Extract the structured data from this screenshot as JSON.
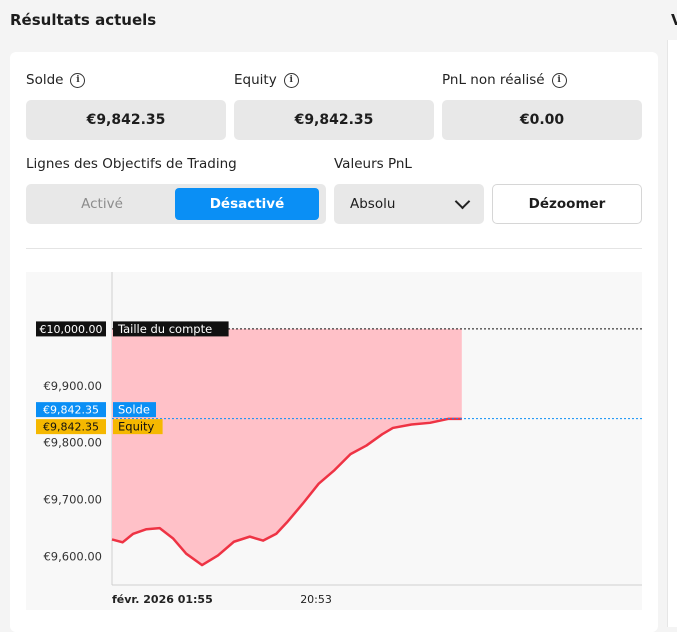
{
  "page": {
    "title": "Résultats actuels",
    "edge_text": "V"
  },
  "metrics": [
    {
      "label": "Solde",
      "value": "€9,842.35"
    },
    {
      "label": "Equity",
      "value": "€9,842.35"
    },
    {
      "label": "PnL non réalisé",
      "value": "€0.00"
    }
  ],
  "controls": {
    "trading_lines_label": "Lignes des Objectifs de Trading",
    "toggle_off": "Activé",
    "toggle_on": "Désactivé",
    "toggle_selected": "Désactivé",
    "pnl_label": "Valeurs PnL",
    "pnl_value": "Absolu",
    "zoom_label": "Dézoomer"
  },
  "colors": {
    "accent": "#0a8ff5",
    "equity": "#f5b800",
    "line": "#ee3344",
    "area": "#ffc1c8",
    "tag_dark": "#111111"
  },
  "chart_data": {
    "type": "area",
    "ylim": [
      9550,
      10100
    ],
    "yticks": [
      {
        "label": "€9,600.00",
        "value": 9600
      },
      {
        "label": "€9,700.00",
        "value": 9700
      },
      {
        "label": "€9,800.00",
        "value": 9800
      },
      {
        "label": "€9,900.00",
        "value": 9900
      }
    ],
    "xticks": [
      {
        "label": "févr. 2026 01:55",
        "pos": 0.0,
        "bold": true
      },
      {
        "label": "20:53",
        "pos": 0.385,
        "bold": false
      }
    ],
    "series": [
      {
        "x": [
          0,
          0.02,
          0.04,
          0.065,
          0.09,
          0.115,
          0.14,
          0.17,
          0.2,
          0.23,
          0.26,
          0.285,
          0.31,
          0.33,
          0.36,
          0.39,
          0.42,
          0.45,
          0.48,
          0.51,
          0.53,
          0.565,
          0.6,
          0.635,
          0.66
        ],
        "values": [
          9630,
          9625,
          9640,
          9648,
          9650,
          9632,
          9605,
          9585,
          9602,
          9626,
          9635,
          9628,
          9640,
          9660,
          9693,
          9728,
          9752,
          9780,
          9795,
          9815,
          9826,
          9832,
          9835,
          9842,
          9842
        ]
      }
    ],
    "reference_lines": [
      {
        "value": 10000,
        "label": "€10,000.00",
        "tag": "Taille du compte",
        "style": "dark"
      },
      {
        "value": 9842.35,
        "label": "€9,842.35",
        "tag": "Solde",
        "style": "blue"
      },
      {
        "value": 9842.35,
        "label": "€9,842.35",
        "tag": "Equity",
        "style": "yellow"
      }
    ]
  }
}
